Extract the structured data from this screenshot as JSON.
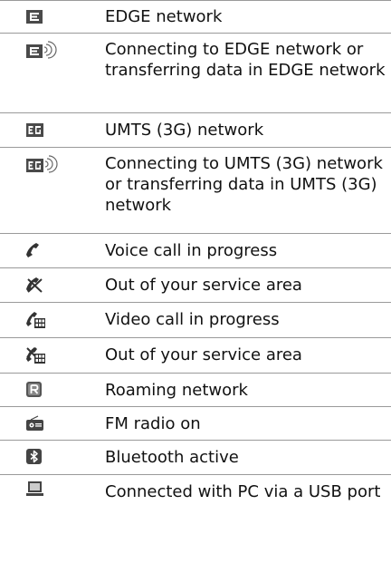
{
  "rows": [
    {
      "icon": "edge-network-icon",
      "text": "EDGE network"
    },
    {
      "icon": "edge-transfer-icon",
      "text": "Connecting to EDGE network or transferring data in EDGE network"
    },
    {
      "icon": "umts-network-icon",
      "text": "UMTS (3G) network"
    },
    {
      "icon": "umts-transfer-icon",
      "text": "Connecting to UMTS (3G) network or transferring data in UMTS (3G) network"
    },
    {
      "icon": "voice-call-icon",
      "text": "Voice call in progress"
    },
    {
      "icon": "voice-out-of-service-icon",
      "text": "Out of your service area"
    },
    {
      "icon": "video-call-icon",
      "text": "Video call in progress"
    },
    {
      "icon": "video-out-of-service-icon",
      "text": "Out of your service area"
    },
    {
      "icon": "roaming-icon",
      "text": "Roaming network"
    },
    {
      "icon": "fm-radio-icon",
      "text": "FM radio on"
    },
    {
      "icon": "bluetooth-icon",
      "text": "Bluetooth active"
    },
    {
      "icon": "pc-usb-icon",
      "text": "Connected with PC via a USB port"
    }
  ]
}
